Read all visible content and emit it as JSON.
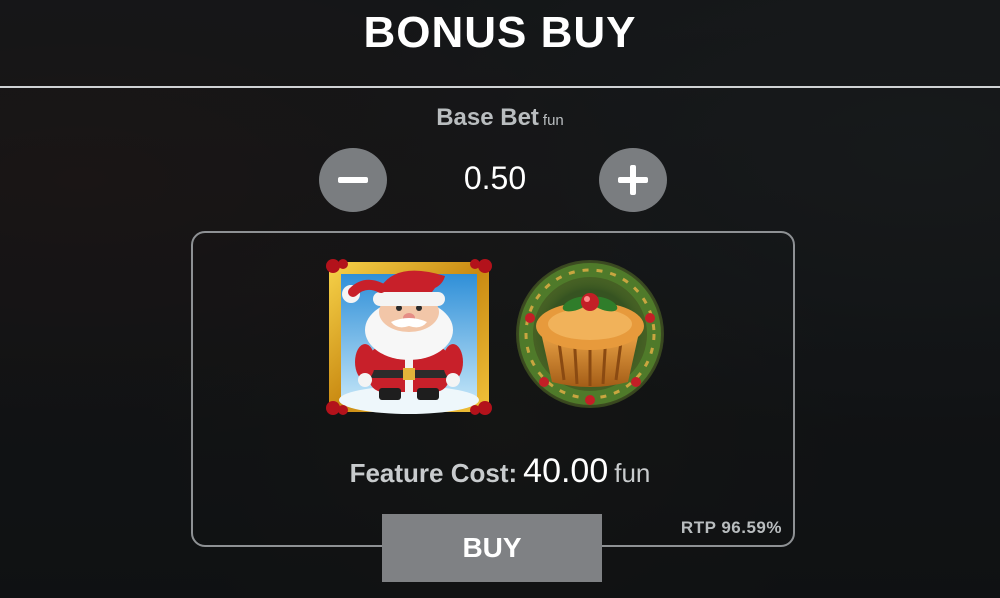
{
  "title": "BONUS BUY",
  "base_bet": {
    "label": "Base Bet",
    "currency": "fun",
    "value": "0.50",
    "decrease_icon": "minus-icon",
    "increase_icon": "plus-icon"
  },
  "feature": {
    "symbols": [
      "santa-symbol",
      "pie-symbol"
    ],
    "cost_label": "Feature Cost:",
    "cost_value": "40.00",
    "cost_currency": "fun",
    "rtp": "RTP 96.59%"
  },
  "buy_label": "BUY",
  "colors": {
    "background": "#14171a",
    "button_gray": "#7f8184",
    "frame_gold": "#d9a21b",
    "santa_red": "#c8202a"
  }
}
